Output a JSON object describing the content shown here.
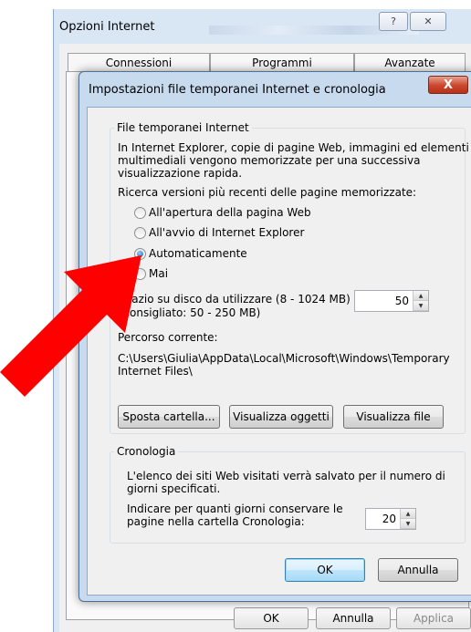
{
  "outer_window": {
    "title": "Opzioni Internet",
    "help_icon": "question-mark-icon",
    "close_icon": "close-x-icon",
    "tabs": [
      "Connessioni",
      "Programmi",
      "Avanzate"
    ],
    "buttons": {
      "ok": "OK",
      "cancel": "Annulla",
      "apply": "Applica"
    }
  },
  "dialog": {
    "title": "Impostazioni file temporanei Internet e cronologia",
    "temp_files": {
      "group_label": "File temporanei Internet",
      "description": [
        "In Internet Explorer, copie di pagine Web, immagini ed elementi",
        "multimediali vengono memorizzate per una successiva",
        "visualizzazione rapida."
      ],
      "check_label": "Ricerca versioni più recenti delle pagine memorizzate:",
      "options": [
        "All'apertura della pagina Web",
        "All'avvio di Internet Explorer",
        "Automaticamente",
        "Mai"
      ],
      "selected_option": "Automaticamente",
      "disk_space_label": [
        "Spazio su disco da utilizzare (8 - 1024 MB)",
        "(Consigliato: 50 - 250 MB)"
      ],
      "disk_space_value": "50",
      "current_path_label": "Percorso corrente:",
      "current_path": [
        "C:\\Users\\Giulia\\AppData\\Local\\Microsoft\\Windows\\Temporary",
        "Internet Files\\"
      ],
      "buttons": {
        "move": "Sposta cartella...",
        "view_objects": "Visualizza oggetti",
        "view_files": "Visualizza file"
      }
    },
    "history": {
      "group_label": "Cronologia",
      "description": [
        "L'elenco dei siti Web visitati verrà salvato per il numero di",
        "giorni specificati."
      ],
      "days_label": [
        "Indicare per quanti giorni conservare le",
        "pagine nella cartella Cronologia:"
      ],
      "days_value": "20"
    },
    "buttons": {
      "ok": "OK",
      "cancel": "Annulla"
    }
  },
  "annotation": {
    "arrow_color": "#ff0000",
    "arrow_icon": "red-arrow-annotation"
  }
}
